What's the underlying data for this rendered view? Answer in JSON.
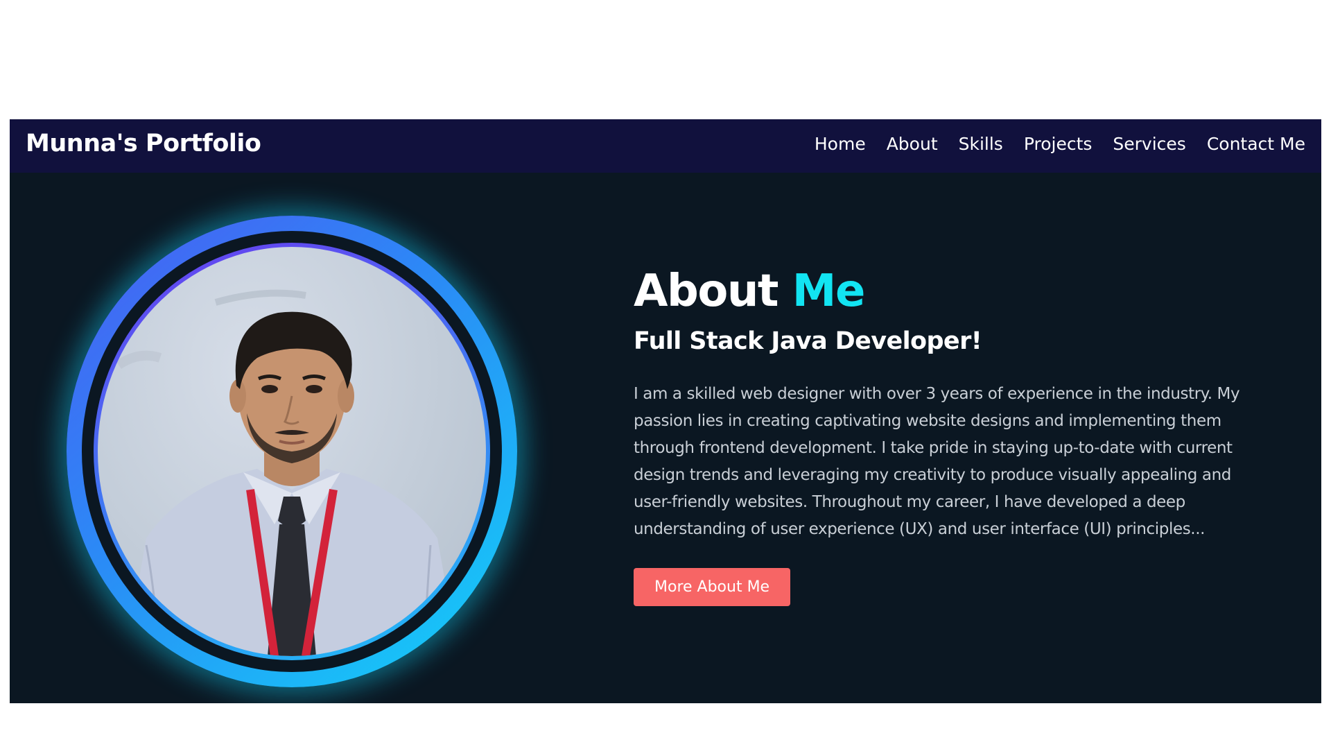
{
  "navbar": {
    "brand": "Munna's Portfolio",
    "links": [
      "Home",
      "About",
      "Skills",
      "Projects",
      "Services",
      "Contact Me"
    ]
  },
  "about": {
    "title_main": "About",
    "title_accent": "Me",
    "subtitle": "Full Stack Java Developer!",
    "paragraph": "I am a skilled web designer with over 3 years of experience in the industry. My passion lies in creating captivating website designs and implementing them through frontend development. I take pride in staying up-to-date with current design trends and leveraging my creativity to produce visually appealing and user-friendly websites. Throughout my career, I have developed a deep understanding of user experience (UX) and user interface (UI) principles...",
    "button_label": "More About Me"
  },
  "colors": {
    "navbar_bg": "#11113d",
    "section_bg": "#0b1722",
    "accent": "#12e4f2",
    "button_bg": "#f76565"
  }
}
